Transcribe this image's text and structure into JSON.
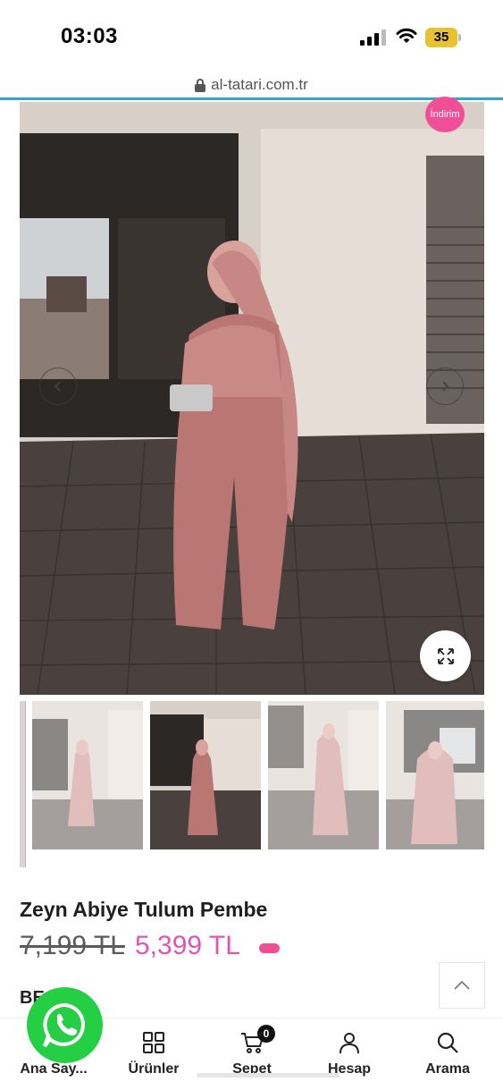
{
  "status_bar": {
    "time": "03:03",
    "battery": "35",
    "icons": [
      "signal-icon",
      "wifi-icon",
      "battery-icon"
    ]
  },
  "browser": {
    "url": "al-tatari.com.tr",
    "icons": [
      "lock-icon"
    ]
  },
  "gallery": {
    "badge": "İndirim",
    "icons": [
      "chevron-left-icon",
      "chevron-right-icon",
      "expand-icon"
    ],
    "thumbnail_count": 4
  },
  "product": {
    "title": "Zeyn Abiye Tulum Pembe",
    "old_price": "7,199 TL",
    "new_price": "5,399 TL",
    "sku": "BE        36"
  },
  "colors": {
    "accent": "#f04f97",
    "price": "#e055b3",
    "whatsapp": "#25cf43",
    "load_line": "#2fa6cf"
  },
  "bottom_nav": {
    "items": [
      {
        "label": "Ana Say...",
        "icon": "home-icon"
      },
      {
        "label": "Ürünler",
        "icon": "grid-icon"
      },
      {
        "label": "Sepet",
        "icon": "cart-icon",
        "count": "0"
      },
      {
        "label": "Hesap",
        "icon": "user-icon"
      },
      {
        "label": "Arama",
        "icon": "search-icon"
      }
    ]
  },
  "floating": {
    "icons": [
      "whatsapp-icon",
      "chevron-up-icon"
    ]
  }
}
